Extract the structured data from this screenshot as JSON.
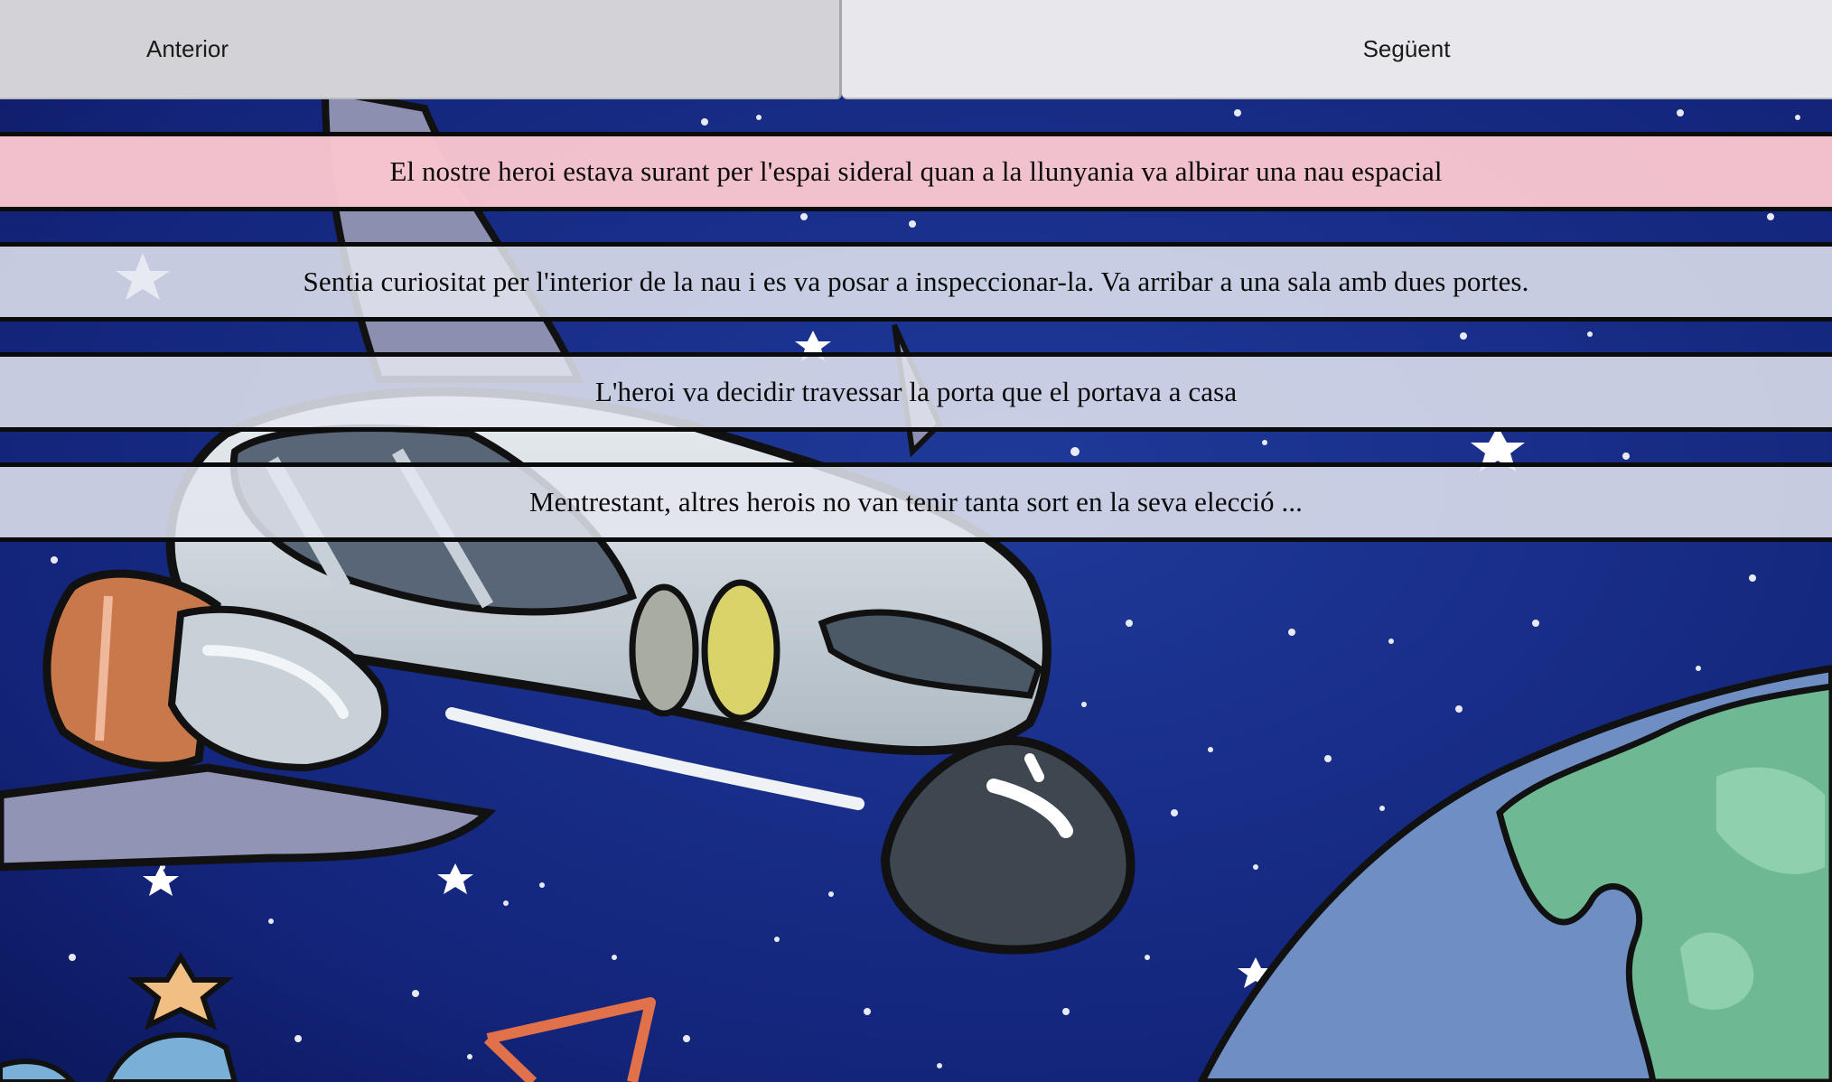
{
  "navigation": {
    "previous_label": "Anterior",
    "next_label": "Següent"
  },
  "story": {
    "options": [
      {
        "text": "El nostre heroi estava surant per l'espai sideral quan a la llunyania va albirar una nau espacial",
        "highlighted": true
      },
      {
        "text": "Sentia curiositat per l'interior de la nau i es va posar a inspeccionar-la. Va arribar a una sala amb dues portes.",
        "highlighted": false
      },
      {
        "text": "L'heroi va decidir travessar la porta que el portava a casa",
        "highlighted": false
      },
      {
        "text": "Mentrestant, altres herois no van tenir tanta sort en la seva elecció ...",
        "highlighted": false
      }
    ]
  },
  "background": {
    "image": "cartoon-space-shuttle-over-earth",
    "colors": {
      "space": "#0f1f6e",
      "highlight_strip": "#f6c4ce",
      "strip": "#e4e6f0",
      "nav_previous": "#d2d2d7",
      "nav_next": "#e8e7ec"
    }
  }
}
